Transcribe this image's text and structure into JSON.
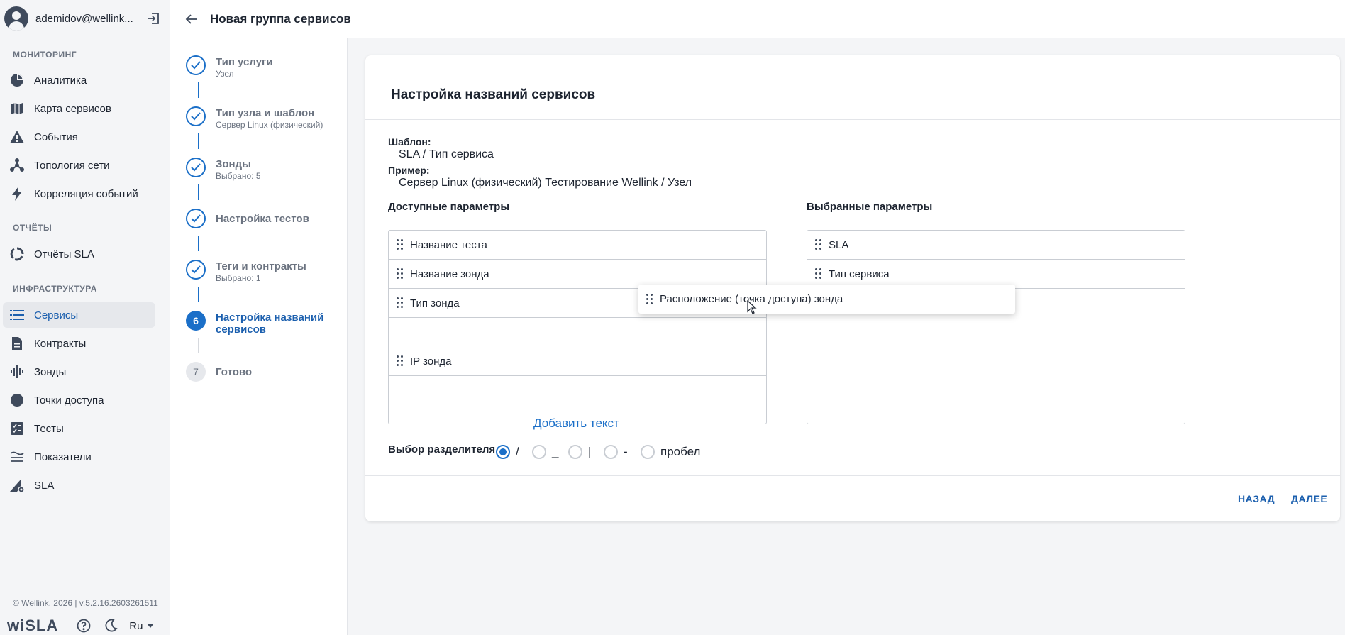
{
  "user": {
    "name": "ademidov@wellink..."
  },
  "sidebar": {
    "sections": [
      {
        "title": "МОНИТОРИНГ"
      },
      {
        "title": "ОТЧЁТЫ"
      },
      {
        "title": "ИНФРАСТРУКТУРА"
      }
    ],
    "items": [
      {
        "label": "Аналитика",
        "icon": "pie-chart-icon"
      },
      {
        "label": "Карта сервисов",
        "icon": "map-icon"
      },
      {
        "label": "События",
        "icon": "warning-icon"
      },
      {
        "label": "Топология сети",
        "icon": "topology-icon"
      },
      {
        "label": "Корреляция событий",
        "icon": "lightning-icon"
      },
      {
        "label": "Отчёты SLA",
        "icon": "report-ring-icon"
      },
      {
        "label": "Сервисы",
        "icon": "list-icon",
        "active": true
      },
      {
        "label": "Контракты",
        "icon": "document-icon"
      },
      {
        "label": "Зонды",
        "icon": "waveform-icon"
      },
      {
        "label": "Точки доступа",
        "icon": "circle-icon"
      },
      {
        "label": "Тесты",
        "icon": "checklist-icon"
      },
      {
        "label": "Показатели",
        "icon": "lines-icon"
      },
      {
        "label": "SLA",
        "icon": "sla-icon"
      }
    ],
    "copyright": "© Wellink, 2026 | v.5.2.16.2603261511",
    "logo": "wiSLA",
    "language": "Ru"
  },
  "header": {
    "title": "Новая группа сервисов"
  },
  "stepper": {
    "steps": [
      {
        "label": "Тип услуги",
        "sub": "Узел",
        "state": "done"
      },
      {
        "label": "Тип узла и шаблон",
        "sub": "Сервер Linux (физический)",
        "state": "done"
      },
      {
        "label": "Зонды",
        "sub": "Выбрано: 5",
        "state": "done"
      },
      {
        "label": "Настройка тестов",
        "sub": "",
        "state": "done"
      },
      {
        "label": "Теги и контракты",
        "sub": "Выбрано: 1",
        "state": "done"
      },
      {
        "label": "Настройка названий сервисов",
        "sub": "",
        "state": "current",
        "number": "6"
      },
      {
        "label": "Готово",
        "sub": "",
        "state": "todo",
        "number": "7"
      }
    ]
  },
  "card": {
    "title": "Настройка названий сервисов",
    "template_label": "Шаблон:",
    "template_value": "SLA / Тип сервиса",
    "example_label": "Пример:",
    "example_value": "Сервер Linux (физический) Тестирование Wellink / Узел",
    "available_label": "Доступные параметры",
    "selected_label": "Выбранные параметры",
    "available": [
      "Название теста",
      "Название зонда",
      "Тип зонда",
      "IP зонда"
    ],
    "selected": [
      "SLA",
      "Тип сервиса"
    ],
    "dragging": "Расположение (точка доступа) зонда",
    "add_text": "Добавить текст",
    "separator_label": "Выбор разделителя",
    "separators": [
      {
        "label": "/",
        "checked": true
      },
      {
        "label": "_",
        "checked": false
      },
      {
        "label": "|",
        "checked": false
      },
      {
        "label": "-",
        "checked": false
      },
      {
        "label": "пробел",
        "checked": false
      }
    ],
    "back": "НАЗАД",
    "next": "ДАЛЕЕ"
  },
  "colors": {
    "accent": "#1b6fc8",
    "accent_text": "#1b5fae",
    "muted": "#6b7380"
  }
}
